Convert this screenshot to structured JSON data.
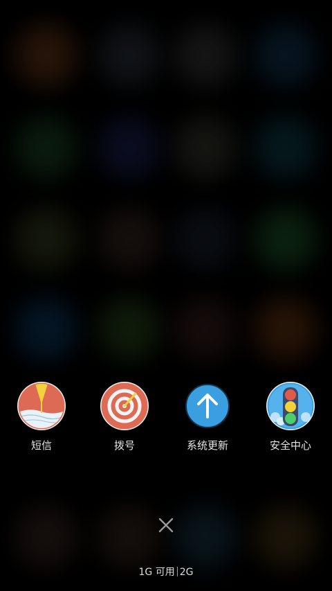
{
  "background": {
    "blobs": [
      {
        "color": "#6a3a1a"
      },
      {
        "color": "#2d3540"
      },
      {
        "color": "#3a3a3a"
      },
      {
        "color": "#123a58"
      },
      {
        "color": "#1e4a26"
      },
      {
        "color": "#1d2458"
      },
      {
        "color": "#3a3a32"
      },
      {
        "color": "#10434f"
      },
      {
        "color": "#3a4220"
      },
      {
        "color": "#3a2a24"
      },
      {
        "color": "#1b2332"
      },
      {
        "color": "#1f5a2c"
      },
      {
        "color": "#0f3d66"
      },
      {
        "color": "#2b4a1c"
      },
      {
        "color": "#3a2220"
      },
      {
        "color": "#6a3614"
      },
      {
        "color": "#3a2824"
      },
      {
        "color": "#3a2820"
      },
      {
        "color": "#1a3a4a"
      },
      {
        "color": "#4a3a18"
      }
    ]
  },
  "recent_apps": [
    {
      "label": "短信",
      "icon": "messaging-icon"
    },
    {
      "label": "拨号",
      "icon": "dialer-icon"
    },
    {
      "label": "系统更新",
      "icon": "system-update-icon"
    },
    {
      "label": "安全中心",
      "icon": "security-center-icon"
    }
  ],
  "close_icon": "close-icon",
  "memory": {
    "available": "1G 可用",
    "total": "2G"
  }
}
